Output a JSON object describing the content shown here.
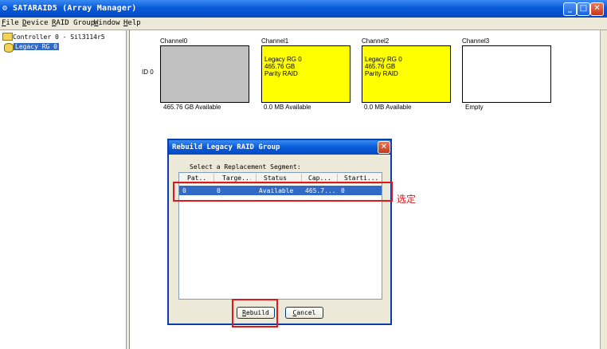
{
  "window": {
    "title": "SATARAID5 (Array Manager)",
    "minimize": "_",
    "maximize": "□",
    "close": "✕"
  },
  "menu": [
    {
      "hot": "F",
      "rest": "ile"
    },
    {
      "hot": "D",
      "rest": "evice"
    },
    {
      "hot": "R",
      "rest": "AID Group"
    },
    {
      "hot": "W",
      "rest": "indow"
    },
    {
      "hot": "H",
      "rest": "elp"
    }
  ],
  "tree": {
    "controller": "Controller 0 - Sil3114r5",
    "raid_group": "Legacy RG 0"
  },
  "array": {
    "row_label": "ID 0",
    "channels": [
      {
        "name": "Channel0",
        "lines": [],
        "available": "465.76 GB Available",
        "color": "#c0c0c0"
      },
      {
        "name": "Channel1",
        "lines": [
          "Legacy RG 0",
          "465.76 GB",
          "Parity RAID"
        ],
        "available": "0.0 MB Available",
        "color": "#ffff00"
      },
      {
        "name": "Channel2",
        "lines": [
          "Legacy RG 0",
          "465.76 GB",
          "Parity RAID"
        ],
        "available": "0.0 MB Available",
        "color": "#ffff00"
      },
      {
        "name": "Channel3",
        "lines": [],
        "available": "Empty",
        "color": "#ffffff"
      }
    ]
  },
  "dialog": {
    "title": "Rebuild Legacy RAID Group",
    "close": "✕",
    "prompt": "Select a Replacement Segment:",
    "columns": [
      "Pat...",
      "Targe...",
      "Status",
      "Cap...",
      "Starti..."
    ],
    "rows": [
      [
        "0",
        "0",
        "Available",
        "465.7...",
        "0"
      ]
    ],
    "rebuild_hot": "R",
    "rebuild_rest": "ebuild",
    "cancel_hot": "C",
    "cancel_rest": "ancel"
  },
  "annotation": {
    "note": "选定",
    "color": "#e0181c"
  }
}
